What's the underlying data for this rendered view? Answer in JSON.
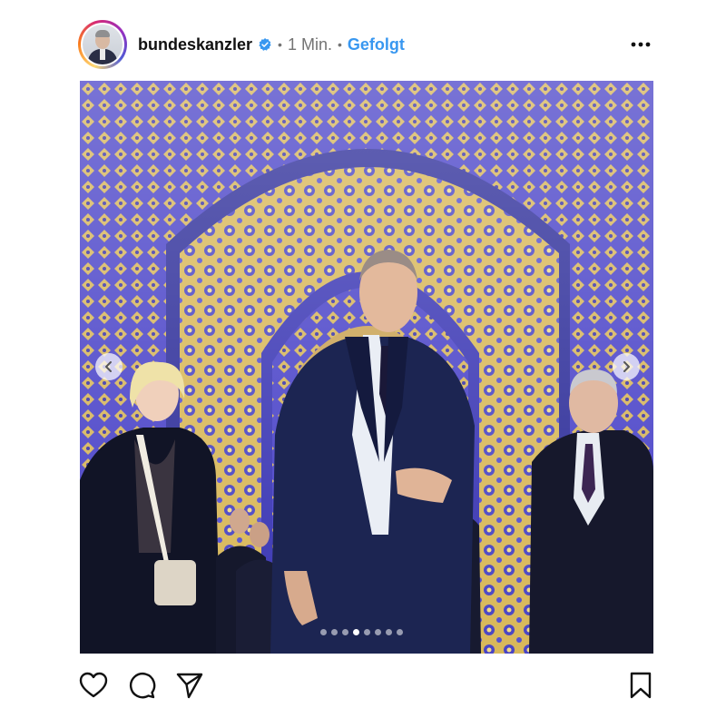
{
  "post": {
    "username": "bundeskanzler",
    "verified": true,
    "time": "1 Min.",
    "separator": "•",
    "follow_status": "Gefolgt"
  },
  "carousel": {
    "total_slides": 8,
    "current_slide": 4
  },
  "icons": {
    "verified": "verified-badge-icon",
    "more": "more-options-icon",
    "prev": "chevron-left-icon",
    "next": "chevron-right-icon",
    "like": "heart-icon",
    "comment": "comment-bubble-icon",
    "share": "paper-plane-icon",
    "save": "bookmark-icon"
  },
  "colors": {
    "follow": "#3897f0",
    "verified": "#3897f0",
    "meta_gray": "#737373"
  }
}
